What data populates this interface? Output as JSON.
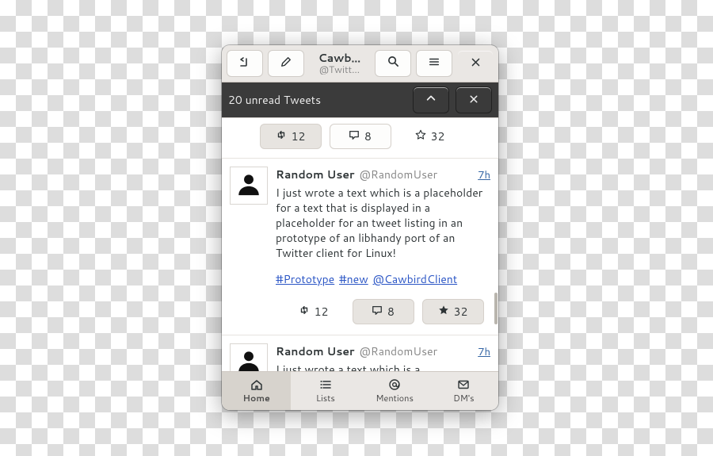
{
  "header": {
    "title": "Cawb…",
    "subtitle": "@Twitt…"
  },
  "banner": {
    "text": "20 unread Tweets"
  },
  "top_actions": {
    "retweet": "12",
    "quote": "8",
    "like": "32"
  },
  "tweets": [
    {
      "name": "Random User",
      "handle": "@RandomUser",
      "time": "7h",
      "text": "I just wrote a text which is a placeholder for a text that is displayed in a placeholder for an tweet listing in an prototype of an libhandy port of an Twitter client for Linux!",
      "links": {
        "tag1": "#Prototype",
        "tag2": "#new",
        "mention": "@CawbirdClient"
      },
      "counts": {
        "retweet": "12",
        "quote": "8",
        "like": "32"
      }
    },
    {
      "name": "Random User",
      "handle": "@RandomUser",
      "time": "7h",
      "text_partial": "I just wrote a text which is a"
    }
  ],
  "nav": {
    "home": "Home",
    "lists": "Lists",
    "mentions": "Mentions",
    "dms": "DM's"
  }
}
